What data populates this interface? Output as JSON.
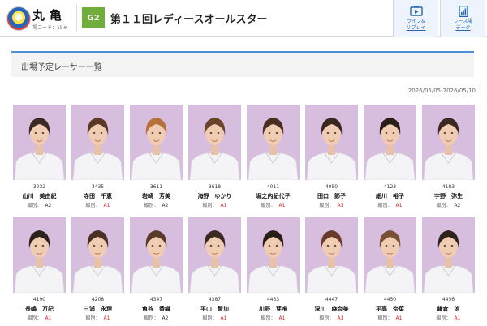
{
  "header": {
    "venue_name": "丸亀",
    "venue_code": "場コード：15#",
    "grade": "G2",
    "race_title": "第１１回レディースオールスター",
    "live_label_1": "ライブ&",
    "live_label_2": "リプレイ",
    "data_label_1": "レース場",
    "data_label_2": "データ"
  },
  "section": {
    "title": "出場予定レーサー一覧",
    "date_range": "2026/05/05-2026/05/10"
  },
  "rank_label": "級別：",
  "racers": [
    {
      "reg": "3232",
      "name": "山川　美由紀",
      "rank": "A2"
    },
    {
      "reg": "3435",
      "name": "寺田　千恵",
      "rank": "A1"
    },
    {
      "reg": "3611",
      "name": "岩崎　芳美",
      "rank": "A2"
    },
    {
      "reg": "3618",
      "name": "海野　ゆかり",
      "rank": "A1"
    },
    {
      "reg": "4011",
      "name": "堀之内紀代子",
      "rank": "A1"
    },
    {
      "reg": "4050",
      "name": "田口　節子",
      "rank": "A1"
    },
    {
      "reg": "4123",
      "name": "細川　裕子",
      "rank": "A1"
    },
    {
      "reg": "4183",
      "name": "宇野　弥生",
      "rank": "A2"
    },
    {
      "reg": "4190",
      "name": "長嶋　万記",
      "rank": "A1"
    },
    {
      "reg": "4208",
      "name": "三浦　永理",
      "rank": "A1"
    },
    {
      "reg": "4347",
      "name": "魚谷　香織",
      "rank": "A2"
    },
    {
      "reg": "4387",
      "name": "平山　智加",
      "rank": "A1"
    },
    {
      "reg": "4433",
      "name": "川野　芽唯",
      "rank": "A1"
    },
    {
      "reg": "4447",
      "name": "深川　麻奈美",
      "rank": "A1"
    },
    {
      "reg": "4450",
      "name": "平高　奈菜",
      "rank": "A1"
    },
    {
      "reg": "4456",
      "name": "鎌倉　涼",
      "rank": "A1"
    }
  ],
  "colors": {
    "accent_blue": "#2866b0",
    "grade_green": "#6fae3b",
    "rank_a1": "#e02020",
    "photo_bg": "#d7bedf"
  }
}
